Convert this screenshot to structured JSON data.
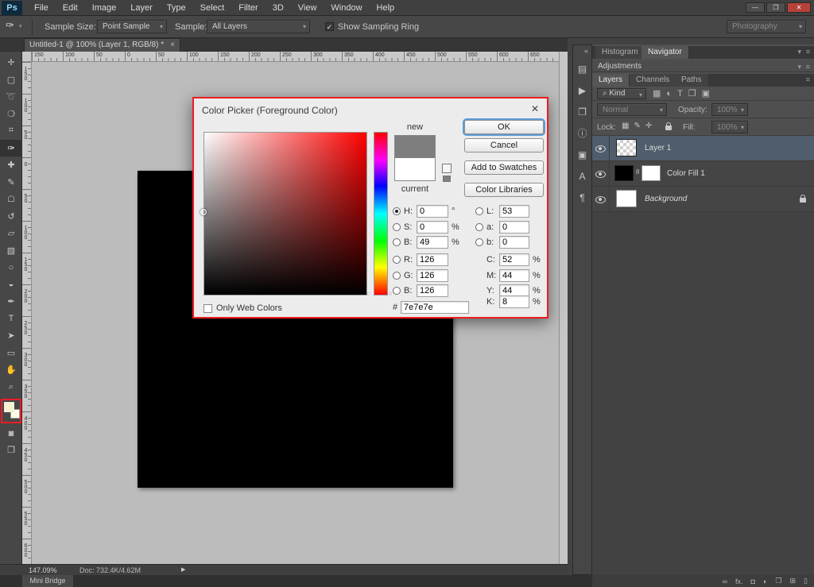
{
  "colors": {
    "annotation_red": "#ed1c24",
    "ok_focus_ring": "#5b9bd5",
    "selected_layer_bg": "#4f5d6c",
    "new_color": "#7e7e7e",
    "current_color": "#ffffff"
  },
  "window": {
    "logo": "Ps",
    "controls": {
      "minimize": "—",
      "restore": "❐",
      "close": "✕"
    }
  },
  "menubar": {
    "items": [
      "File",
      "Edit",
      "Image",
      "Layer",
      "Type",
      "Select",
      "Filter",
      "3D",
      "View",
      "Window",
      "Help"
    ]
  },
  "options_bar": {
    "tool_icon": "✑",
    "tool_arrow": "▾",
    "sample_size_label": "Sample Size:",
    "sample_size_value": "Point Sample",
    "sample_label": "Sample:",
    "sample_value": "All Layers",
    "sampling_ring_check": "✓",
    "sampling_ring_label": "Show Sampling Ring",
    "workspace_value": "Photography"
  },
  "document_tab": {
    "title": "Untitled-1 @ 100% (Layer 1, RGB/8) *",
    "close": "×"
  },
  "toolbar": {
    "tools": [
      {
        "name": "move-tool",
        "glyph": "✛"
      },
      {
        "name": "marquee-tool",
        "glyph": "▢"
      },
      {
        "name": "lasso-tool",
        "glyph": "➰"
      },
      {
        "name": "quick-selection-tool",
        "glyph": "❍"
      },
      {
        "name": "crop-tool",
        "glyph": "⌗"
      },
      {
        "name": "eyedropper-tool",
        "glyph": "✑",
        "selected": true
      },
      {
        "name": "healing-brush-tool",
        "glyph": "✚"
      },
      {
        "name": "brush-tool",
        "glyph": "✎"
      },
      {
        "name": "clone-stamp-tool",
        "glyph": "☖"
      },
      {
        "name": "history-brush-tool",
        "glyph": "↺"
      },
      {
        "name": "eraser-tool",
        "glyph": "▱"
      },
      {
        "name": "gradient-tool",
        "glyph": "▧"
      },
      {
        "name": "blur-tool",
        "glyph": "○"
      },
      {
        "name": "dodge-tool",
        "glyph": "◒"
      },
      {
        "name": "pen-tool",
        "glyph": "✒"
      },
      {
        "name": "type-tool",
        "glyph": "T"
      },
      {
        "name": "path-selection-tool",
        "glyph": "➤"
      },
      {
        "name": "shape-tool",
        "glyph": "▭"
      },
      {
        "name": "hand-tool",
        "glyph": "✋"
      },
      {
        "name": "zoom-tool",
        "glyph": "⌕"
      }
    ],
    "bottom_tools": [
      {
        "name": "quick-mask-button",
        "glyph": "◙"
      },
      {
        "name": "screen-mode-button",
        "glyph": "❐"
      }
    ]
  },
  "ruler": {
    "horizontal": [
      "150",
      "100",
      "50",
      "0",
      "50",
      "100",
      "150",
      "200",
      "250",
      "300",
      "350",
      "400",
      "450",
      "500",
      "550",
      "600",
      "650"
    ],
    "vertical": [
      "150",
      "100",
      "50",
      "0",
      "50",
      "100",
      "150",
      "200",
      "250",
      "300",
      "350",
      "400",
      "450",
      "500",
      "550",
      "600"
    ]
  },
  "color_picker": {
    "title": "Color Picker (Foreground Color)",
    "close": "✕",
    "new_label": "new",
    "current_label": "current",
    "new_color": "#7e7e7e",
    "current_color": "#ffffff",
    "hue_arrow_left": "▸",
    "hue_arrow_right": "◂",
    "ok": "OK",
    "cancel": "Cancel",
    "add_to_swatches": "Add to Swatches",
    "color_libraries": "Color Libraries",
    "h_label": "H:",
    "h_value": "0",
    "h_unit": "°",
    "s_label": "S:",
    "s_value": "0",
    "s_unit": "%",
    "b_label": "B:",
    "b_value": "49",
    "b_unit": "%",
    "r_label": "R:",
    "r_value": "126",
    "g_label": "G:",
    "g_value": "126",
    "b2_label": "B:",
    "b2_value": "126",
    "l_label": "L:",
    "l_value": "53",
    "a_label": "a:",
    "a_value": "0",
    "bb_label": "b:",
    "bb_value": "0",
    "c_label": "C:",
    "c_value": "52",
    "c_unit": "%",
    "m_label": "M:",
    "m_value": "44",
    "m_unit": "%",
    "y_label": "Y:",
    "y_value": "44",
    "y_unit": "%",
    "k_label": "K:",
    "k_value": "8",
    "k_unit": "%",
    "hex_label": "#",
    "hex_value": "7e7e7e",
    "only_web_label": "Only Web Colors"
  },
  "panel_strip": {
    "collapse": "«",
    "icons": [
      {
        "name": "histogram-panel-icon",
        "glyph": "▤"
      },
      {
        "name": "actions-panel-icon",
        "glyph": "▶"
      },
      {
        "name": "clone-source-panel-icon",
        "glyph": "❐"
      },
      {
        "name": "info-panel-icon",
        "glyph": "ⓘ"
      },
      {
        "name": "layer-comps-panel-icon",
        "glyph": "▣"
      },
      {
        "name": "character-panel-icon",
        "glyph": "A"
      },
      {
        "name": "paragraph-panel-icon",
        "glyph": "¶"
      }
    ]
  },
  "panels": {
    "chevron_icon": "▾",
    "panel_menu_icon": "≡",
    "histogram_tab": "Histogram",
    "navigator_tab": "Navigator",
    "adjustments_title": "Adjustments",
    "layers_tab": "Layers",
    "channels_tab": "Channels",
    "paths_tab": "Paths",
    "kind_icon": "⌕",
    "kind_label": "Kind",
    "filter_icons": [
      {
        "name": "filter-pixel-layers-icon",
        "glyph": "▦"
      },
      {
        "name": "filter-adjustment-layers-icon",
        "glyph": "◐"
      },
      {
        "name": "filter-type-layers-icon",
        "glyph": "T"
      },
      {
        "name": "filter-shape-layers-icon",
        "glyph": "❒"
      },
      {
        "name": "filter-smart-objects-icon",
        "glyph": "▣"
      }
    ],
    "blend_mode": "Normal",
    "opacity_label": "Opacity:",
    "opacity_value": "100%",
    "lock_label": "Lock:",
    "lock_icons": [
      {
        "name": "lock-transparency-icon",
        "glyph": "▦"
      },
      {
        "name": "lock-paint-icon",
        "glyph": "✎"
      },
      {
        "name": "lock-position-icon",
        "glyph": "✛"
      }
    ],
    "fill_label": "Fill:",
    "fill_value": "100%",
    "mask_link_glyph": "8",
    "layers": {
      "layer1": "Layer 1",
      "color_fill": "Color Fill 1",
      "background": "Background"
    },
    "bottom_icons": [
      {
        "name": "link-layers-icon",
        "glyph": "∞"
      },
      {
        "name": "layer-effects-icon",
        "glyph": "fx."
      },
      {
        "name": "layer-mask-icon",
        "glyph": "◘"
      },
      {
        "name": "adjustment-layer-icon",
        "glyph": "◐"
      },
      {
        "name": "layer-group-icon",
        "glyph": "❒"
      },
      {
        "name": "new-layer-icon",
        "glyph": "⊞"
      },
      {
        "name": "delete-layer-icon",
        "glyph": "▯"
      }
    ]
  },
  "statusbar": {
    "zoom": "147.09%",
    "doc_info": "Doc: 732.4K/4.62M",
    "expand_arrow": "▶",
    "mini_bridge": "Mini Bridge"
  }
}
